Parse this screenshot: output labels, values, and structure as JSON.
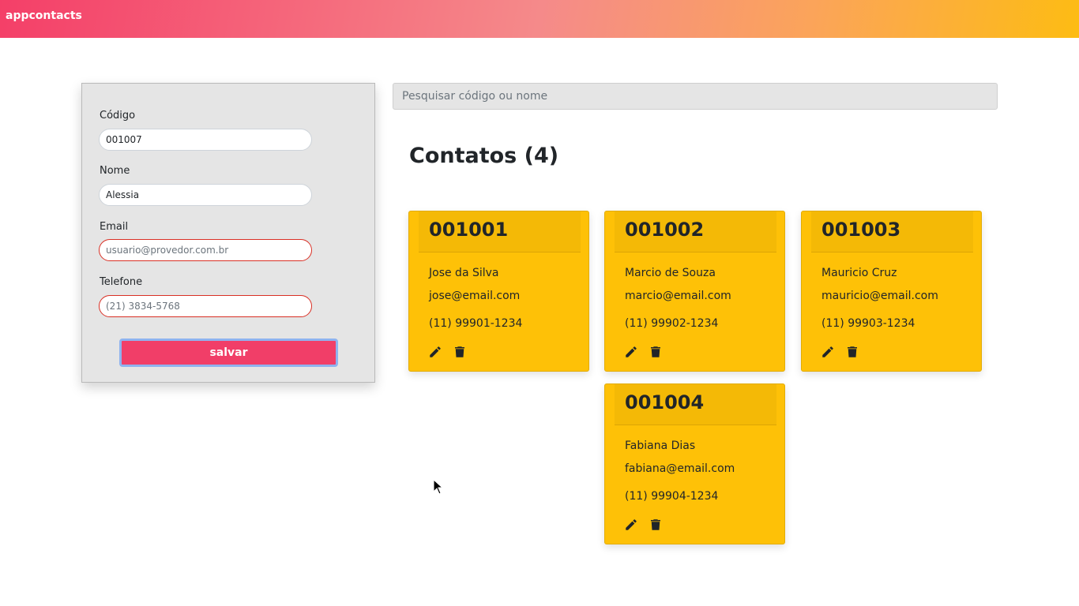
{
  "app": {
    "brand": "appcontacts"
  },
  "form": {
    "codigo_label": "Código",
    "codigo_value": "001007",
    "nome_label": "Nome",
    "nome_value": "Alessia",
    "email_label": "Email",
    "email_placeholder": "usuario@provedor.com.br",
    "telefone_label": "Telefone",
    "telefone_placeholder": "(21) 3834-5768",
    "save_label": "salvar"
  },
  "search": {
    "placeholder": "Pesquisar código ou nome"
  },
  "contacts": {
    "title": "Contatos (4)",
    "items": [
      {
        "code": "001001",
        "name": "Jose da Silva",
        "email": "jose@email.com",
        "phone": "(11) 99901-1234"
      },
      {
        "code": "001002",
        "name": "Marcio de Souza",
        "email": "marcio@email.com",
        "phone": "(11) 99902-1234"
      },
      {
        "code": "001003",
        "name": "Mauricio Cruz",
        "email": "mauricio@email.com",
        "phone": "(11) 99903-1234"
      },
      {
        "code": "001004",
        "name": "Fabiana Dias",
        "email": "fabiana@email.com",
        "phone": "(11) 99904-1234"
      }
    ]
  },
  "icons": {
    "edit": "pencil-icon",
    "delete": "trash-icon"
  },
  "colors": {
    "brand_gradient_start": "#f43f68",
    "brand_gradient_end": "#fdbc13",
    "save_button": "#f13e68",
    "card": "#fec107",
    "invalid_border": "#d93025"
  }
}
